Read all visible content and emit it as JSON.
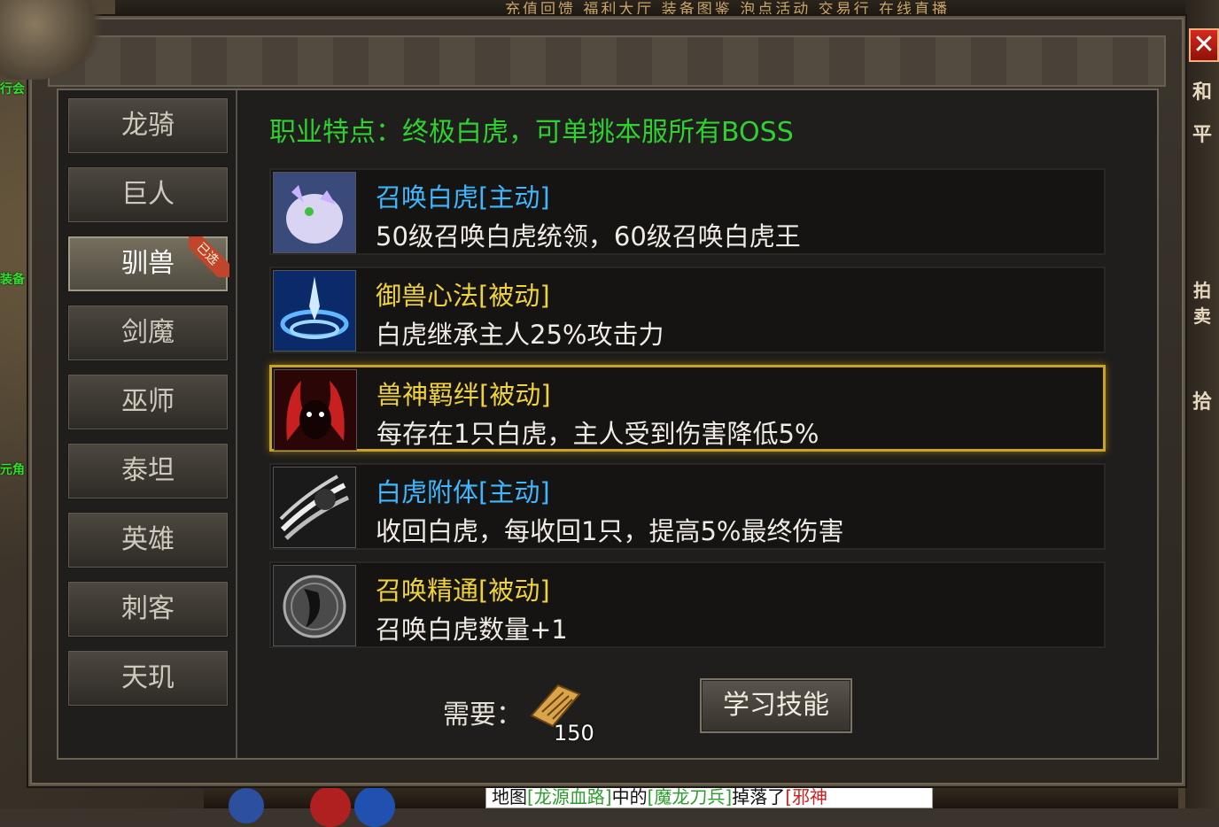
{
  "topbar": {
    "text": "充值回馈  福利大厅  装备图鉴  泡点活动  交易行  在线直播"
  },
  "left_labels": [
    "行会",
    "装备",
    "元角"
  ],
  "right_rail": {
    "b1": "和",
    "b2": "平",
    "b3": "拍卖",
    "b4": "拾"
  },
  "chat": {
    "pre": "地图",
    "map": "[龙源血路]",
    "mid": "中的",
    "monster": "[魔龙刀兵]",
    "post": "掉落了",
    "item": "[邪神"
  },
  "dialog": {
    "close_label": "✕"
  },
  "classes": [
    {
      "label": "龙骑",
      "active": false
    },
    {
      "label": "巨人",
      "active": false
    },
    {
      "label": "驯兽",
      "active": true,
      "badge": "已选"
    },
    {
      "label": "剑魔",
      "active": false
    },
    {
      "label": "巫师",
      "active": false
    },
    {
      "label": "泰坦",
      "active": false
    },
    {
      "label": "英雄",
      "active": false
    },
    {
      "label": "刺客",
      "active": false
    },
    {
      "label": "天玑",
      "active": false
    }
  ],
  "trait": "职业特点：终极白虎，可单挑本服所有BOSS",
  "skills": [
    {
      "name": "召唤白虎[主动]",
      "type": "active",
      "color": "#3fb7ff",
      "desc": "50级召唤白虎统领，60级召唤白虎王",
      "icon": "white-tiger-summon-icon"
    },
    {
      "name": "御兽心法[被动]",
      "type": "passive",
      "color": "#f0d23a",
      "desc": "白虎继承主人25%攻击力",
      "icon": "beast-mind-icon"
    },
    {
      "name": "兽神羁绊[被动]",
      "type": "passive",
      "color": "#f0d23a",
      "desc": "每存在1只白虎，主人受到伤害降低5%",
      "icon": "beast-god-bond-icon",
      "selected": true
    },
    {
      "name": "白虎附体[主动]",
      "type": "active",
      "color": "#3fb7ff",
      "desc": "收回白虎，每收回1只，提高5%最终伤害",
      "icon": "tiger-possession-icon"
    },
    {
      "name": "召唤精通[被动]",
      "type": "passive",
      "color": "#f0d23a",
      "desc": "召唤白虎数量+1",
      "icon": "summon-mastery-icon"
    }
  ],
  "requirement": {
    "label": "需要：",
    "count": "150",
    "item_icon": "skill-scroll-icon"
  },
  "learn_button": "学习技能"
}
